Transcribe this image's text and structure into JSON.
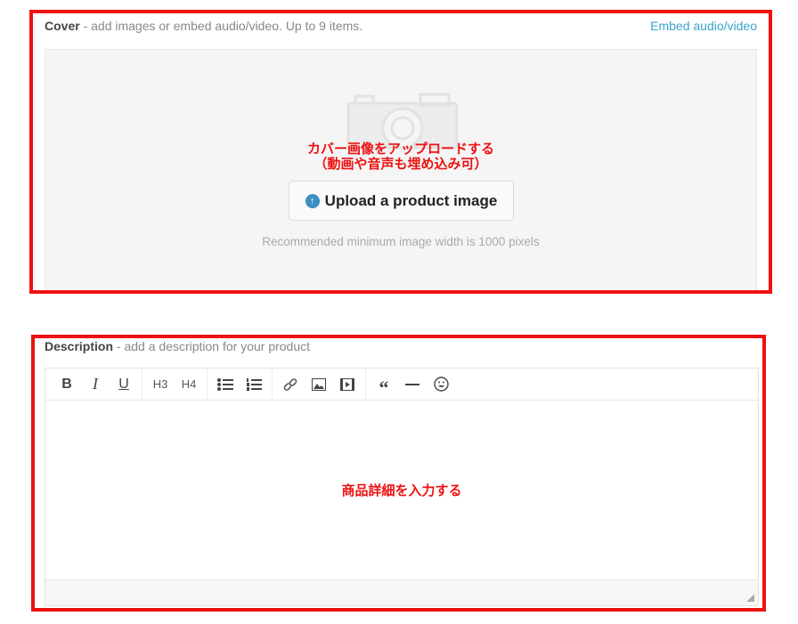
{
  "cover": {
    "title": "Cover",
    "subtitle": " - add images or embed audio/video. Up to 9 items.",
    "embed_link": "Embed audio/video",
    "annotation_line1": "カバー画像をアップロードする",
    "annotation_line2": "（動画や音声も埋め込み可）",
    "upload_button": "Upload a product image",
    "recommendation": "Recommended minimum image width is 1000 pixels"
  },
  "description": {
    "title": "Description",
    "subtitle": " - add a description for your product",
    "toolbar": {
      "bold": "B",
      "italic": "I",
      "underline": "U",
      "h3": "H3",
      "h4": "H4"
    },
    "annotation": "商品詳細を入力する"
  },
  "colors": {
    "annotation": "#ee1111",
    "link": "#3ba3c9",
    "upload_icon": "#3b8fc2"
  }
}
